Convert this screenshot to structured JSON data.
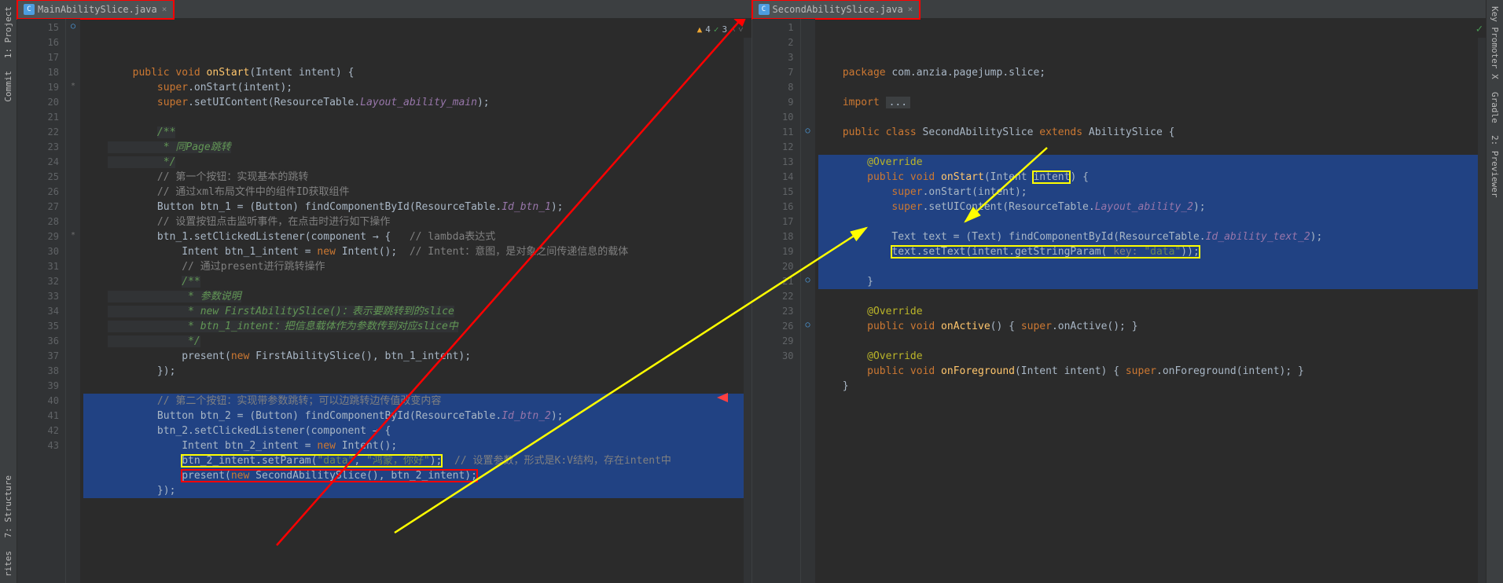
{
  "tabs": {
    "left": "MainAbilitySlice.java",
    "right": "SecondAbilitySlice.java"
  },
  "sidebars": {
    "left": [
      "1: Project",
      "Commit",
      "7: Structure",
      "rites"
    ],
    "right": [
      "Key Promoter X",
      "Gradle",
      "2: Previewer"
    ]
  },
  "inspection": {
    "warnings": "4",
    "checks": "3"
  },
  "left_code": {
    "lines": [
      {
        "n": "15",
        "cls": "",
        "html": "    <span class='kw'>public void</span> <span class='ident'>onStart</span>(Intent intent) {"
      },
      {
        "n": "16",
        "cls": "",
        "html": "        <span class='kw'>super</span>.onStart(intent);"
      },
      {
        "n": "17",
        "cls": "",
        "html": "        <span class='kw'>super</span>.setUIContent(ResourceTable.<span class='field'>Layout_ability_main</span>);"
      },
      {
        "n": "18",
        "cls": "",
        "html": ""
      },
      {
        "n": "19",
        "cls": "",
        "html": "        <span class='doccomment'>/**</span>"
      },
      {
        "n": "20",
        "cls": "",
        "html": "<span class='doccomment'>         * 同Page跳转</span>"
      },
      {
        "n": "21",
        "cls": "",
        "html": "<span class='doccomment'>         */</span>"
      },
      {
        "n": "22",
        "cls": "",
        "html": "        <span class='comment'>// 第一个按钮：实现基本的跳转</span>"
      },
      {
        "n": "23",
        "cls": "",
        "html": "        <span class='comment'>// 通过xml布局文件中的组件ID获取组件</span>"
      },
      {
        "n": "24",
        "cls": "",
        "html": "        Button btn_1 = (Button) findComponentById(ResourceTable.<span class='field'>Id_btn_1</span>);"
      },
      {
        "n": "25",
        "cls": "",
        "html": "        <span class='comment'>// 设置按钮点击监听事件，在点击时进行如下操作</span>"
      },
      {
        "n": "26",
        "cls": "",
        "html": "        btn_1.setClickedListener(component → {   <span class='comment'>// lambda表达式</span>"
      },
      {
        "n": "27",
        "cls": "",
        "html": "            Intent btn_1_intent = <span class='kw'>new</span> Intent();  <span class='comment'>// Intent：意图，是对象之间传递信息的载体</span>"
      },
      {
        "n": "28",
        "cls": "",
        "html": "            <span class='comment'>// 通过present进行跳转操作</span>"
      },
      {
        "n": "29",
        "cls": "",
        "html": "            <span class='doccomment'>/**</span>"
      },
      {
        "n": "30",
        "cls": "",
        "html": "<span class='doccomment'>             * 参数说明</span>"
      },
      {
        "n": "31",
        "cls": "",
        "html": "<span class='doccomment'>             * new FirstAbilitySlice()：表示要跳转到的slice</span>"
      },
      {
        "n": "32",
        "cls": "",
        "html": "<span class='doccomment'>             * btn_1_intent：把信息载体作为参数传到对应slice中</span>"
      },
      {
        "n": "33",
        "cls": "",
        "html": "<span class='doccomment'>             */</span>"
      },
      {
        "n": "34",
        "cls": "",
        "html": "            present(<span class='kw'>new</span> FirstAbilitySlice(), btn_1_intent);"
      },
      {
        "n": "35",
        "cls": "",
        "html": "        });"
      },
      {
        "n": "36",
        "cls": "",
        "html": ""
      },
      {
        "n": "37",
        "cls": "hl-block",
        "html": "        <span class='comment'>// 第二个按钮：实现带参数跳转；可以边跳转边传值改变内容</span>"
      },
      {
        "n": "38",
        "cls": "hl-block",
        "html": "        Button btn_2 = (Button) findComponentById(ResourceTable.<span class='field'>Id_btn_2</span>);"
      },
      {
        "n": "39",
        "cls": "hl-block",
        "html": "        btn_2.setClickedListener(component → {"
      },
      {
        "n": "40",
        "cls": "hl-block",
        "html": "            Intent btn_2_intent = <span class='kw'>new</span> Intent();"
      },
      {
        "n": "41",
        "cls": "hl-block",
        "html": "            <span class='yellow-box'>btn_2_intent.setParam(<span class='str'>\"data\"</span>, <span class='str'>\"鸿蒙，你好\"</span>);</span>  <span class='comment'>// 设置参数，形式是K:V结构，存在intent中</span>"
      },
      {
        "n": "42",
        "cls": "hl-block",
        "html": "            <span class='red-box'>present(<span class='kw'>new</span> SecondAbilitySlice(), btn_2_intent);</span>"
      },
      {
        "n": "43",
        "cls": "hl-block",
        "html": "        });"
      }
    ]
  },
  "right_code": {
    "lines": [
      {
        "n": "1",
        "cls": "",
        "html": "<span class='kw'>package</span> com.anzia.pagejump.slice;"
      },
      {
        "n": "2",
        "cls": "",
        "html": ""
      },
      {
        "n": "3",
        "cls": "",
        "html": "<span class='kw'>import</span> <span style='background:#3c3f41;padding:0 4px'>...</span>"
      },
      {
        "n": "7",
        "cls": "",
        "html": ""
      },
      {
        "n": "8",
        "cls": "",
        "html": "<span class='kw'>public class</span> SecondAbilitySlice <span class='kw'>extends</span> AbilitySlice {"
      },
      {
        "n": "9",
        "cls": "",
        "html": ""
      },
      {
        "n": "10",
        "cls": "hl-block",
        "html": "    <span class='anno'>@Override</span>"
      },
      {
        "n": "11",
        "cls": "hl-block",
        "html": "    <span class='kw'>public void</span> <span class='ident'>onStart</span>(Intent <span class='yellow-box'>intent</span>) {"
      },
      {
        "n": "12",
        "cls": "hl-block",
        "html": "        <span class='kw'>super</span>.onStart(intent);"
      },
      {
        "n": "13",
        "cls": "hl-block",
        "html": "        <span class='kw'>super</span>.setUIContent(ResourceTable.<span class='field'>Layout_ability_2</span>);"
      },
      {
        "n": "14",
        "cls": "hl-block",
        "html": ""
      },
      {
        "n": "15",
        "cls": "hl-block",
        "html": "        Text text = (Text) findComponentById(ResourceTable.<span class='field'>Id_ability_text_2</span>);"
      },
      {
        "n": "16",
        "cls": "hl-block",
        "html": "        <span class='yellow-box'>text.setText(intent.getStringParam( <span class='comment'>key:</span> <span class='str'>\"data\"</span>));</span>"
      },
      {
        "n": "17",
        "cls": "hl-block",
        "html": ""
      },
      {
        "n": "18",
        "cls": "hl-block",
        "html": "    }"
      },
      {
        "n": "19",
        "cls": "",
        "html": ""
      },
      {
        "n": "20",
        "cls": "",
        "html": "    <span class='anno'>@Override</span>"
      },
      {
        "n": "21",
        "cls": "",
        "html": "    <span class='kw'>public void</span> <span class='ident'>onActive</span>() { <span class='kw'>super</span>.onActive(); }"
      },
      {
        "n": "22",
        "cls": "",
        "html": ""
      },
      {
        "n": "23",
        "cls": "",
        "html": "    <span class='anno'>@Override</span>"
      },
      {
        "n": "26",
        "cls": "",
        "html": "    <span class='kw'>public void</span> <span class='ident'>onForeground</span>(Intent intent) { <span class='kw'>super</span>.onForeground(intent); }"
      },
      {
        "n": "29",
        "cls": "",
        "html": "}"
      },
      {
        "n": "30",
        "cls": "",
        "html": ""
      }
    ]
  }
}
